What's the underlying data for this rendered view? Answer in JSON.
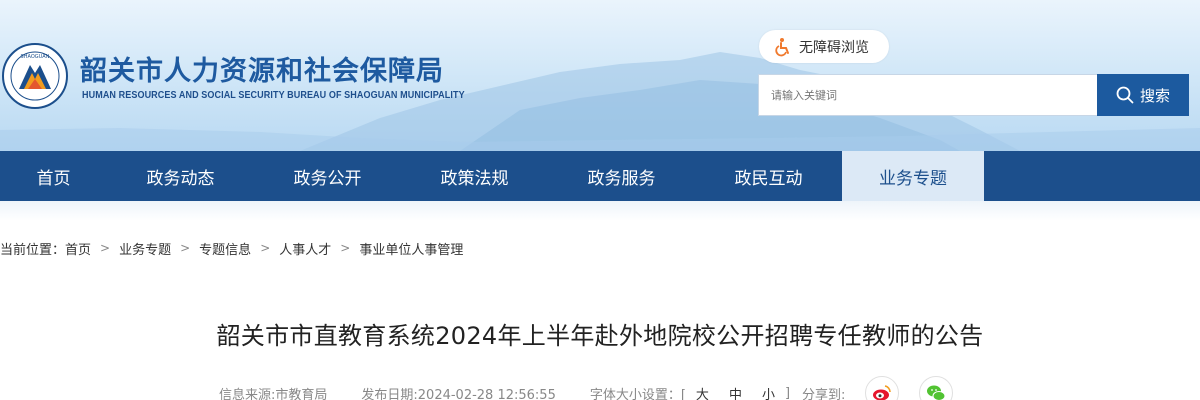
{
  "header": {
    "title": "韶关市人力资源和社会保障局",
    "subtitle": "HUMAN RESOURCES AND SOCIAL SECURITY BUREAU OF SHAOGUAN MUNICIPALITY",
    "accessibility_label": "无障碍浏览",
    "search_placeholder": "请输入关键词",
    "search_button": "搜索"
  },
  "nav": {
    "items": [
      {
        "label": "首页"
      },
      {
        "label": "政务动态"
      },
      {
        "label": "政务公开"
      },
      {
        "label": "政策法规"
      },
      {
        "label": "政务服务"
      },
      {
        "label": "政民互动"
      },
      {
        "label": "业务专题"
      }
    ],
    "active_index": 6
  },
  "breadcrumb": {
    "prefix": "当前位置：",
    "items": [
      "首页",
      "业务专题",
      "专题信息",
      "人事人才",
      "事业单位人事管理"
    ],
    "separator": ">"
  },
  "article": {
    "title": "韶关市市直教育系统2024年上半年赴外地院校公开招聘专任教师的公告",
    "source": "信息来源:市教育局",
    "published": "发布日期:2024-02-28 12:56:55",
    "font_size_label": "字体大小设置：[",
    "font_large": "大",
    "font_medium": "中",
    "font_small": "小",
    "font_close": "]",
    "share_label": "分享到:"
  },
  "colors": {
    "primary": "#1c4f8c",
    "search_button": "#1c5a9f",
    "active_nav_bg": "#dce9f6",
    "weibo": "#e6162d",
    "wechat": "#51c332"
  }
}
